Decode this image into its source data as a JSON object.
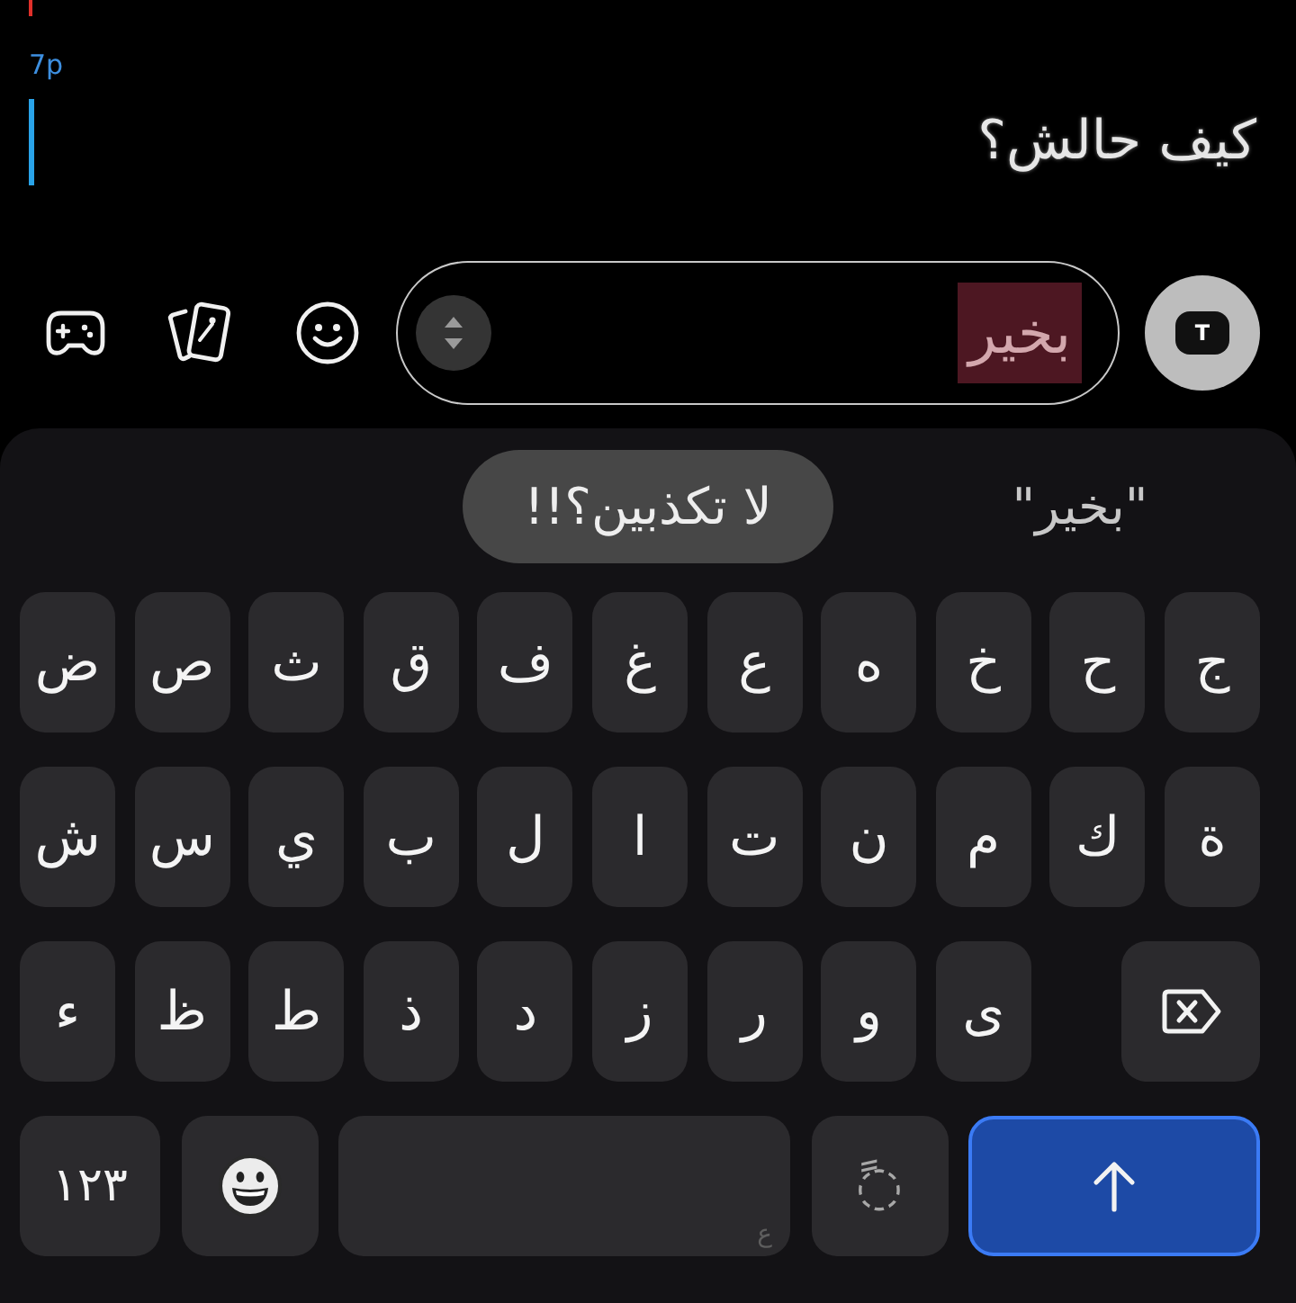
{
  "overlay": {
    "label": "7p"
  },
  "message": {
    "text": "كيف حالش؟"
  },
  "composer": {
    "value": "بخير",
    "value_selected": true,
    "camera_label": "T"
  },
  "keyboard": {
    "suggestions": [
      {
        "kind": "plain",
        "text": "\"بخير\""
      },
      {
        "kind": "chip",
        "text": "لا تكذبين؟!!"
      }
    ],
    "rows": [
      [
        {
          "kind": "letter",
          "label": "ج"
        },
        {
          "kind": "letter",
          "label": "ح"
        },
        {
          "kind": "letter",
          "label": "خ"
        },
        {
          "kind": "letter",
          "label": "ه"
        },
        {
          "kind": "letter",
          "label": "ع"
        },
        {
          "kind": "letter",
          "label": "غ"
        },
        {
          "kind": "letter",
          "label": "ف"
        },
        {
          "kind": "letter",
          "label": "ق"
        },
        {
          "kind": "letter",
          "label": "ث"
        },
        {
          "kind": "letter",
          "label": "ص"
        },
        {
          "kind": "letter",
          "label": "ض"
        }
      ],
      [
        {
          "kind": "letter",
          "label": "ة"
        },
        {
          "kind": "letter",
          "label": "ك"
        },
        {
          "kind": "letter",
          "label": "م"
        },
        {
          "kind": "letter",
          "label": "ن"
        },
        {
          "kind": "letter",
          "label": "ت"
        },
        {
          "kind": "letter",
          "label": "ا"
        },
        {
          "kind": "letter",
          "label": "ل"
        },
        {
          "kind": "letter",
          "label": "ب"
        },
        {
          "kind": "letter",
          "label": "ي"
        },
        {
          "kind": "letter",
          "label": "س"
        },
        {
          "kind": "letter",
          "label": "ش"
        }
      ],
      [
        {
          "kind": "backspace"
        },
        "",
        {
          "kind": "letter",
          "label": "ى"
        },
        {
          "kind": "letter",
          "label": "و"
        },
        {
          "kind": "letter",
          "label": "ر"
        },
        {
          "kind": "letter",
          "label": "ز"
        },
        {
          "kind": "letter",
          "label": "د"
        },
        {
          "kind": "letter",
          "label": "ذ"
        },
        {
          "kind": "letter",
          "label": "ط"
        },
        {
          "kind": "letter",
          "label": "ظ"
        },
        {
          "kind": "letter",
          "label": "ء"
        }
      ]
    ],
    "bottom_row": [
      {
        "kind": "enter"
      },
      {
        "kind": "diacritic",
        "label": "◌ً"
      },
      {
        "kind": "space",
        "label": "ع"
      },
      {
        "kind": "emoji"
      },
      {
        "kind": "numbers",
        "label": "١٢٣"
      }
    ]
  }
}
